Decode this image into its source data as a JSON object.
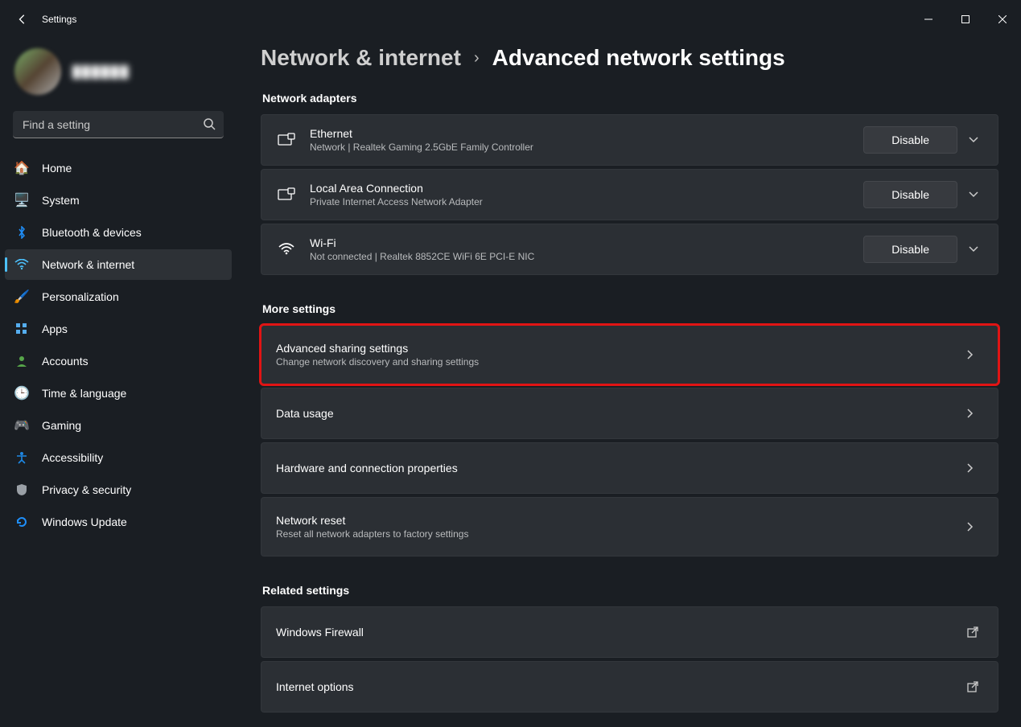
{
  "window": {
    "title": "Settings"
  },
  "profile": {
    "display_name": "██████"
  },
  "search": {
    "placeholder": "Find a setting"
  },
  "sidebar": {
    "items": [
      {
        "id": "home",
        "label": "Home",
        "icon": "home-icon",
        "active": false
      },
      {
        "id": "system",
        "label": "System",
        "icon": "system-icon",
        "active": false
      },
      {
        "id": "bluetooth",
        "label": "Bluetooth & devices",
        "icon": "bluetooth-icon",
        "active": false
      },
      {
        "id": "network",
        "label": "Network & internet",
        "icon": "wifi-icon",
        "active": true
      },
      {
        "id": "personalization",
        "label": "Personalization",
        "icon": "paintbrush-icon",
        "active": false
      },
      {
        "id": "apps",
        "label": "Apps",
        "icon": "apps-icon",
        "active": false
      },
      {
        "id": "accounts",
        "label": "Accounts",
        "icon": "person-icon",
        "active": false
      },
      {
        "id": "time",
        "label": "Time & language",
        "icon": "clock-globe-icon",
        "active": false
      },
      {
        "id": "gaming",
        "label": "Gaming",
        "icon": "gamepad-icon",
        "active": false
      },
      {
        "id": "accessibility",
        "label": "Accessibility",
        "icon": "accessibility-icon",
        "active": false
      },
      {
        "id": "privacy",
        "label": "Privacy & security",
        "icon": "shield-icon",
        "active": false
      },
      {
        "id": "update",
        "label": "Windows Update",
        "icon": "update-icon",
        "active": false
      }
    ]
  },
  "breadcrumb": {
    "parent": "Network & internet",
    "current": "Advanced network settings"
  },
  "sections": {
    "adapters_heading": "Network adapters",
    "adapters": [
      {
        "title": "Ethernet",
        "sub": "Network | Realtek Gaming 2.5GbE Family Controller",
        "button": "Disable",
        "icon": "ethernet-icon"
      },
      {
        "title": "Local Area Connection",
        "sub": "Private Internet Access Network Adapter",
        "button": "Disable",
        "icon": "ethernet-icon"
      },
      {
        "title": "Wi-Fi",
        "sub": "Not connected | Realtek 8852CE WiFi 6E PCI-E NIC",
        "button": "Disable",
        "icon": "wifi-icon"
      }
    ],
    "more_heading": "More settings",
    "more": [
      {
        "title": "Advanced sharing settings",
        "sub": "Change network discovery and sharing settings",
        "highlight": true
      },
      {
        "title": "Data usage",
        "sub": ""
      },
      {
        "title": "Hardware and connection properties",
        "sub": ""
      },
      {
        "title": "Network reset",
        "sub": "Reset all network adapters to factory settings"
      }
    ],
    "related_heading": "Related settings",
    "related": [
      {
        "title": "Windows Firewall"
      },
      {
        "title": "Internet options"
      }
    ]
  }
}
